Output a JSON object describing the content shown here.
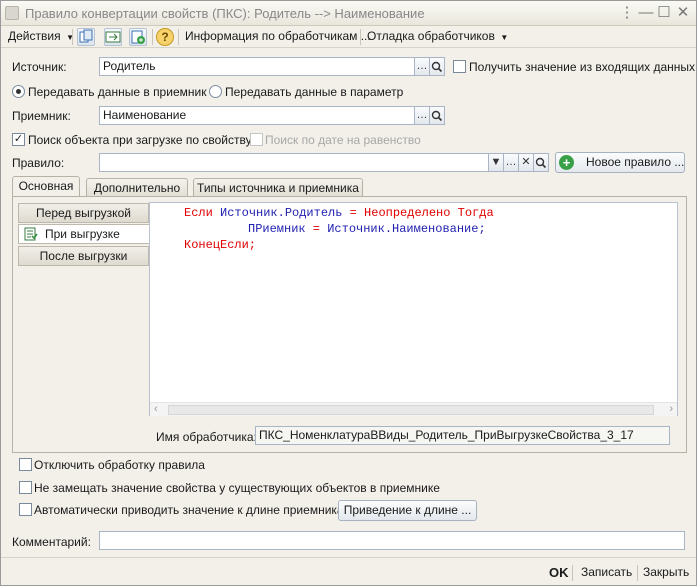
{
  "window": {
    "title": "Правило конвертации свойств (ПКС): Родитель --> Наименование",
    "buttons": [
      "⋮",
      "—",
      "☐",
      "✕"
    ]
  },
  "toolbar": {
    "actions_label": "Действия",
    "info_label": "Информация по обработчикам ...",
    "debug_label": "Отладка обработчиков"
  },
  "form": {
    "source_label": "Источник:",
    "source_value": "Родитель",
    "get_from_incoming_label": "Получить значение из входящих данных",
    "pass_to_receiver_label": "Передавать данные в приемник",
    "pass_to_param_label": "Передавать данные в параметр",
    "receiver_label": "Приемник:",
    "receiver_value": "Наименование",
    "search_by_property_label": "Поиск объекта при загрузке по свойству",
    "search_by_date_label": "Поиск по дате на равенство",
    "rule_label": "Правило:",
    "rule_value": "",
    "new_rule_label": "Новое правило ..."
  },
  "tabs": [
    {
      "label": "Основная"
    },
    {
      "label": "Дополнительно"
    },
    {
      "label": "Типы источника и приемника"
    }
  ],
  "handler_tabs": [
    {
      "label": "Перед выгрузкой"
    },
    {
      "label": "При выгрузке"
    },
    {
      "label": "После выгрузки"
    }
  ],
  "code": {
    "line1": {
      "kw1": "Если",
      "id1": "Источник.Родитель",
      "op": " = ",
      "kw2": "Неопределено Тогда"
    },
    "line2": {
      "id1": "ПРиемник",
      "op": " = ",
      "id2": "Источник.Наименование;"
    },
    "line3": {
      "kw1": "КонецЕсли;"
    }
  },
  "handler_name_label": "Имя обработчика:",
  "handler_name_value": "ПКС_НоменклатураВВиды_Родитель_ПриВыгрузкеСвойства_3_17",
  "options": {
    "disable_rule_label": "Отключить обработку правила",
    "no_replace_label": "Не замещать значение свойства у существующих объектов в приемнике",
    "auto_length_label": "Автоматически приводить значение к длине приемника",
    "length_button_label": "Приведение к длине ..."
  },
  "comment_label": "Комментарий:",
  "comment_value": "",
  "footer": {
    "ok_label": "OK",
    "save_label": "Записать",
    "close_label": "Закрыть"
  },
  "colors": {
    "keyword": "#e00000",
    "identifier": "#1f1fb0"
  }
}
